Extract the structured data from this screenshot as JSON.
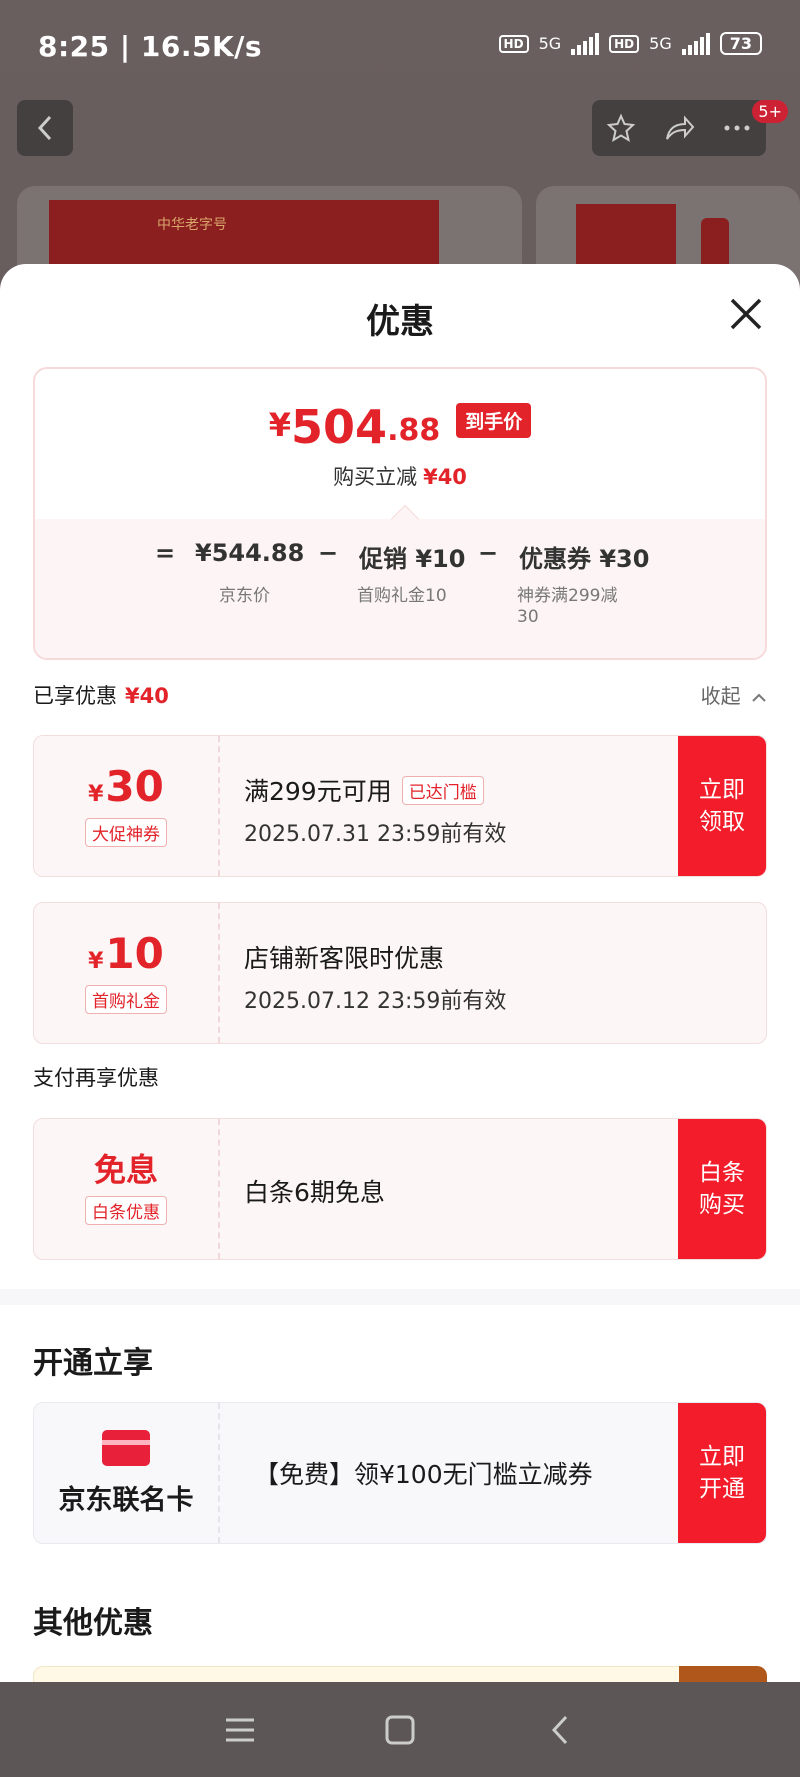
{
  "status_bar": {
    "time_speed": "8:25 | 16.5K/s",
    "hd1": "HD",
    "net1": "5G",
    "hd2": "HD",
    "net2": "5G",
    "battery": "73"
  },
  "background": {
    "badge": "5+",
    "brand_text": "中华老字号"
  },
  "sheet": {
    "title": "优惠",
    "price": {
      "currency": "¥",
      "integer": "504",
      "decimal": ".88",
      "final_tag": "到手价",
      "subtitle_prefix": "购买立减",
      "subtitle_amount": "¥40"
    },
    "breakdown": {
      "equals": "=",
      "base_price": "¥544.88",
      "base_label": "京东价",
      "minus1": "−",
      "promo": "促销 ¥10",
      "promo_label": "首购礼金10",
      "minus2": "−",
      "coupon": "优惠券 ¥30",
      "coupon_label_line1": "神券满299减",
      "coupon_label_line2": "30"
    },
    "enjoyed": {
      "label": "已享优惠",
      "amount": "¥40",
      "collapse": "收起"
    },
    "coupons": [
      {
        "currency": "¥",
        "amount": "30",
        "label": "大促神券",
        "line1": "满299元可用",
        "reached": "已达门槛",
        "line2": "2025.07.31 23:59前有效",
        "action_line1": "立即",
        "action_line2": "领取"
      },
      {
        "currency": "¥",
        "amount": "10",
        "label": "首购礼金",
        "line1": "店铺新客限时优惠",
        "line2": "2025.07.12 23:59前有效"
      }
    ],
    "payment": {
      "heading": "支付再享优惠",
      "amount": "免息",
      "label": "白条优惠",
      "text": "白条6期免息",
      "action_line1": "白条",
      "action_line2": "购买"
    },
    "open": {
      "heading": "开通立享",
      "card_name": "京东联名卡",
      "text": "【免费】领¥100无门槛立减券",
      "action_line1": "立即",
      "action_line2": "开通"
    },
    "other": {
      "heading": "其他优惠"
    }
  },
  "colors": {
    "accent_red": "#e2232a",
    "action_red": "#f21c2b"
  }
}
